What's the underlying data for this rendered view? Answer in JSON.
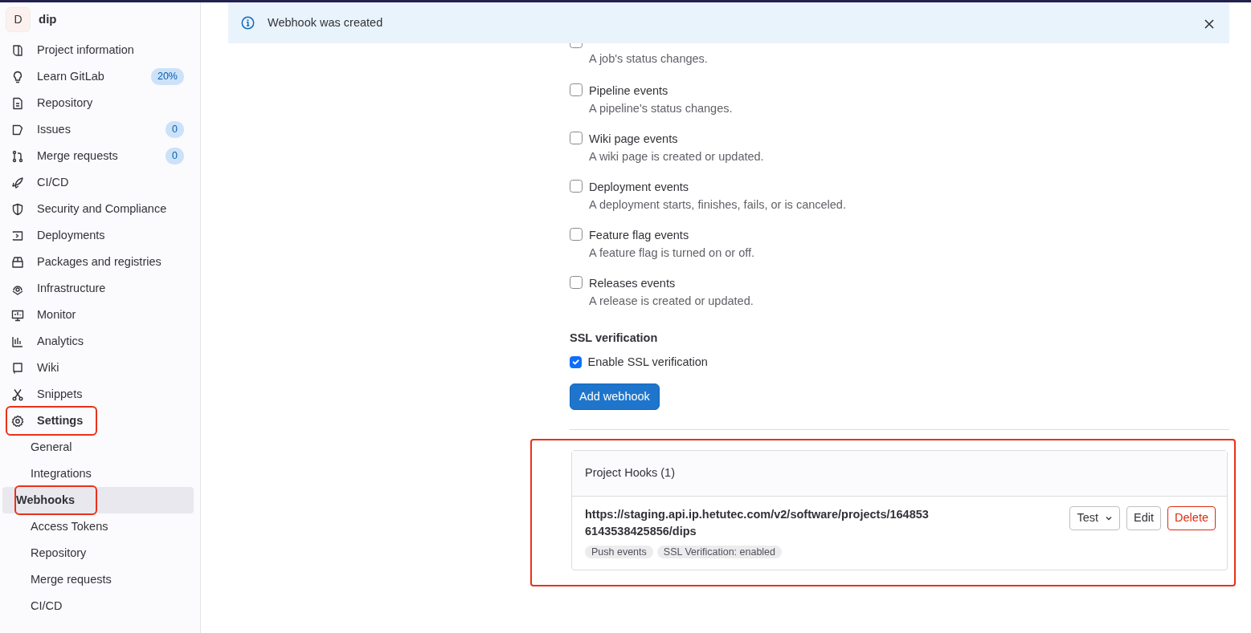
{
  "project": {
    "avatar": "D",
    "name": "dip"
  },
  "sidebar": {
    "items": [
      {
        "label": "Project information",
        "selected": false,
        "highlighted": false
      },
      {
        "label": "Learn GitLab",
        "badge": "20%",
        "selected": false,
        "highlighted": false
      },
      {
        "label": "Repository",
        "selected": false,
        "highlighted": false
      },
      {
        "label": "Issues",
        "badge": "0",
        "selected": false,
        "highlighted": false
      },
      {
        "label": "Merge requests",
        "badge": "0",
        "selected": false,
        "highlighted": false
      },
      {
        "label": "CI/CD",
        "selected": false,
        "highlighted": false
      },
      {
        "label": "Security and Compliance",
        "selected": false,
        "highlighted": false
      },
      {
        "label": "Deployments",
        "selected": false,
        "highlighted": false
      },
      {
        "label": "Packages and registries",
        "selected": false,
        "highlighted": false
      },
      {
        "label": "Infrastructure",
        "selected": false,
        "highlighted": false
      },
      {
        "label": "Monitor",
        "selected": false,
        "highlighted": false
      },
      {
        "label": "Analytics",
        "selected": false,
        "highlighted": false
      },
      {
        "label": "Wiki",
        "selected": false,
        "highlighted": false
      },
      {
        "label": "Snippets",
        "selected": false,
        "highlighted": false
      },
      {
        "label": "Settings",
        "selected": true,
        "highlighted": true,
        "children": [
          {
            "label": "General",
            "selected": false,
            "highlighted": false
          },
          {
            "label": "Integrations",
            "selected": false,
            "highlighted": false
          },
          {
            "label": "Webhooks",
            "selected": true,
            "highlighted": true
          },
          {
            "label": "Access Tokens",
            "selected": false,
            "highlighted": false
          },
          {
            "label": "Repository",
            "selected": false,
            "highlighted": false
          },
          {
            "label": "Merge requests",
            "selected": false,
            "highlighted": false
          },
          {
            "label": "CI/CD",
            "selected": false,
            "highlighted": false
          }
        ]
      }
    ]
  },
  "alert": {
    "message": "Webhook was created"
  },
  "events": [
    {
      "description": "A job's status changes.",
      "checked": false
    },
    {
      "label": "Pipeline events",
      "description": "A pipeline's status changes.",
      "checked": false
    },
    {
      "label": "Wiki page events",
      "description": "A wiki page is created or updated.",
      "checked": false
    },
    {
      "label": "Deployment events",
      "description": "A deployment starts, finishes, fails, or is canceled.",
      "checked": false
    },
    {
      "label": "Feature flag events",
      "description": "A feature flag is turned on or off.",
      "checked": false
    },
    {
      "label": "Releases events",
      "description": "A release is created or updated.",
      "checked": false
    }
  ],
  "ssl": {
    "heading": "SSL verification",
    "label": "Enable SSL verification",
    "checked": true
  },
  "add_button": "Add webhook",
  "hooks": {
    "title": "Project Hooks (1)",
    "highlighted": true,
    "items": [
      {
        "url_lines": [
          "https://staging.api.ip.hetutec.com/v2/software/projects/164853",
          "6143538425856/dips"
        ],
        "tags": [
          "Push events",
          "SSL Verification: enabled"
        ],
        "buttons": [
          {
            "label": "Test",
            "kind": "dropdown"
          },
          {
            "label": "Edit",
            "kind": "default"
          },
          {
            "label": "Delete",
            "kind": "danger"
          }
        ]
      }
    ]
  }
}
